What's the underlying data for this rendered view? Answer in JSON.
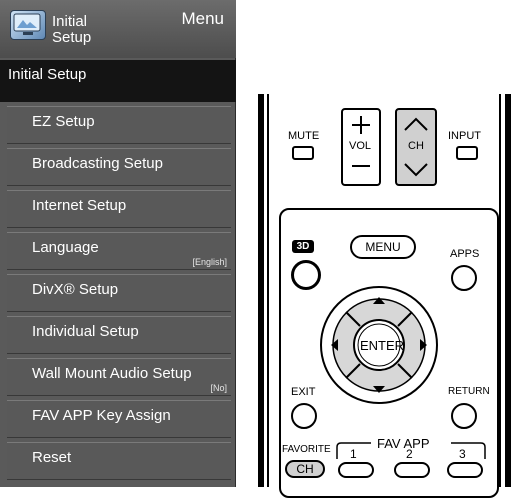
{
  "menu": {
    "header_title": "Initial Setup",
    "header_menu_label": "Menu",
    "selected_label": "Initial Setup",
    "items": [
      {
        "label": "EZ Setup",
        "value": ""
      },
      {
        "label": "Broadcasting Setup",
        "value": ""
      },
      {
        "label": "Internet Setup",
        "value": ""
      },
      {
        "label": "Language",
        "value": "[English]"
      },
      {
        "label": "DivX® Setup",
        "value": ""
      },
      {
        "label": "Individual Setup",
        "value": ""
      },
      {
        "label": "Wall Mount Audio Setup",
        "value": "[No]"
      },
      {
        "label": "FAV APP Key Assign",
        "value": ""
      },
      {
        "label": "Reset",
        "value": ""
      }
    ]
  },
  "remote": {
    "mute": "MUTE",
    "vol": "VOL",
    "ch": "CH",
    "input": "INPUT",
    "three_d": "3D",
    "menu": "MENU",
    "apps": "APPS",
    "enter": "ENTER",
    "exit": "EXIT",
    "return": "RETURN",
    "favorite": "FAVORITE",
    "favorite_ch": "CH",
    "fav_app": "FAV APP",
    "fav_keys": [
      "1",
      "2",
      "3"
    ]
  }
}
